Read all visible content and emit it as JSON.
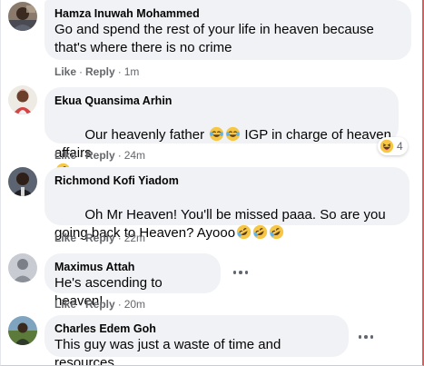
{
  "comments": [
    {
      "author": "Hamza Inuwah Mohammed",
      "text": "Go and spend the rest of your life in heaven because that's where there is no crime",
      "like": "Like",
      "reply": "Reply",
      "time": "1m"
    },
    {
      "author": "Ekua Quansima Arhin",
      "text_a": "Our heavenly father ",
      "text_b": " IGP in charge of heaven affairs",
      "like": "Like",
      "reply": "Reply",
      "time": "24m",
      "reactions_count": "4"
    },
    {
      "author": "Richmond Kofi Yiadom",
      "text_a": "Oh Mr Heaven! You'll be missed paaa. So are you going back to Heaven? Ayooo",
      "like": "Like",
      "reply": "Reply",
      "time": "22m"
    },
    {
      "author": "Maximus Attah",
      "text": "He's ascending to heaven!",
      "like": "Like",
      "reply": "Reply",
      "time": "20m"
    },
    {
      "author": "Charles Edem Goh",
      "text": "This guy was just a waste of time and resources"
    }
  ],
  "separator": "·",
  "icons": {
    "emoji_laugh": "face-with-tears-of-joy",
    "emoji_rofl": "rolling-on-floor-laughing",
    "reaction": "haha-reaction",
    "more": "more-options-horizontal"
  },
  "colors": {
    "bubble": "#f0f2f5",
    "meta": "#65676b",
    "emoji_yellow": "#f7c744"
  }
}
